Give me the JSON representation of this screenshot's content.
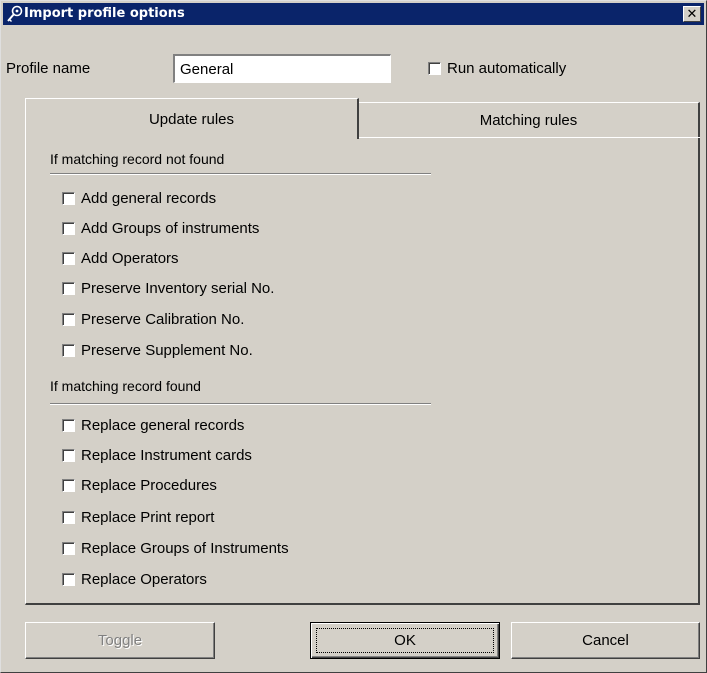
{
  "window": {
    "title": "Import profile options",
    "close_glyph": "✕"
  },
  "profile": {
    "label": "Profile name",
    "value": "General"
  },
  "run_automatically": {
    "label": "Run automatically",
    "checked": false
  },
  "tabs": [
    {
      "label": "Update rules",
      "active": true
    },
    {
      "label": "Matching rules",
      "active": false
    }
  ],
  "groups": {
    "not_found": {
      "label": "If matching record not found",
      "options": [
        {
          "label": "Add general records",
          "checked": false
        },
        {
          "label": "Add Groups of instruments",
          "checked": false
        },
        {
          "label": "Add Operators",
          "checked": false
        },
        {
          "label": "Preserve Inventory serial No.",
          "checked": false
        },
        {
          "label": "Preserve Calibration No.",
          "checked": false
        },
        {
          "label": "Preserve Supplement No.",
          "checked": false
        }
      ]
    },
    "found": {
      "label": "If matching record found",
      "options": [
        {
          "label": "Replace general records",
          "checked": false
        },
        {
          "label": "Replace Instrument cards",
          "checked": false
        },
        {
          "label": "Replace Procedures",
          "checked": false
        },
        {
          "label": "Replace Print report",
          "checked": false
        },
        {
          "label": "Replace Groups of Instruments",
          "checked": false
        },
        {
          "label": "Replace Operators",
          "checked": false
        }
      ]
    }
  },
  "buttons": {
    "toggle": "Toggle",
    "ok": "OK",
    "cancel": "Cancel"
  },
  "colors": {
    "titlebar": "#0a246a",
    "face": "#d4d0c8",
    "disabled_text": "#808080"
  },
  "icons": {
    "title": "key-wrench-icon"
  }
}
